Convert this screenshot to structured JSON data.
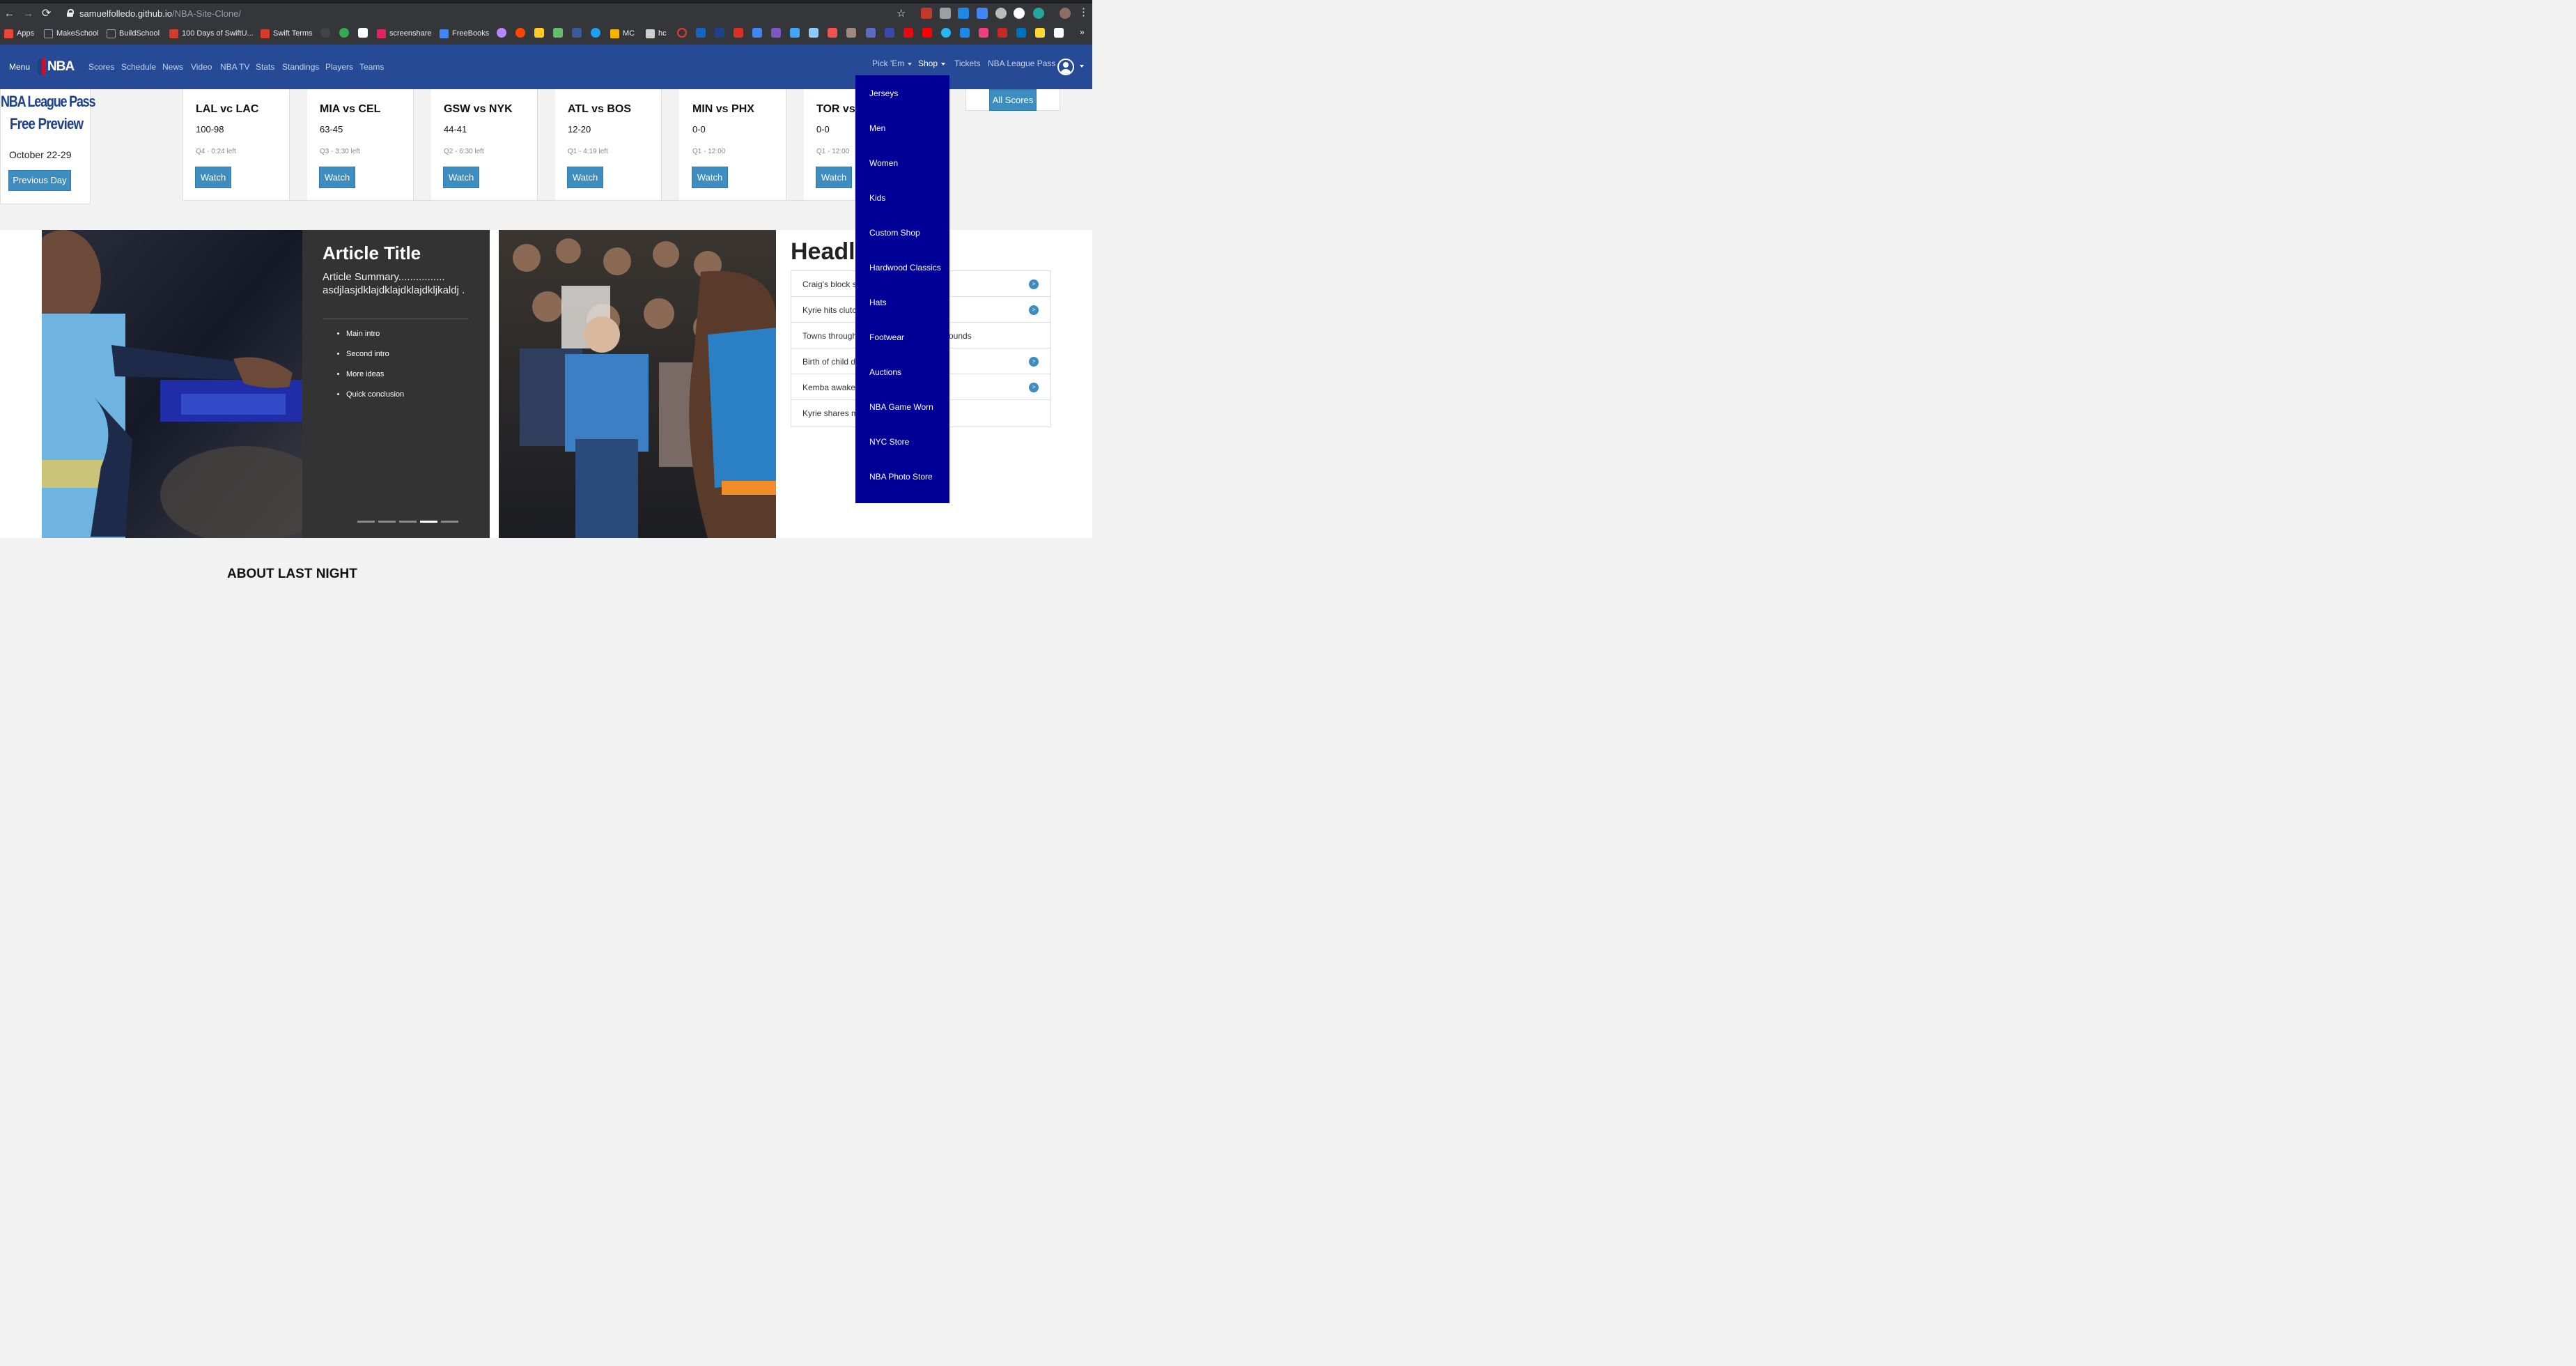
{
  "browser": {
    "url_host": "samuelfolledo.github.io",
    "url_path": "/NBA-Site-Clone/",
    "bookmarks": [
      {
        "label": "Apps",
        "color": "#e8453c"
      },
      {
        "label": "MakeSchool",
        "color": "#9aa0a6"
      },
      {
        "label": "BuildSchool",
        "color": "#9aa0a6"
      },
      {
        "label": "100 Days of SwiftU...",
        "color": "#d33b2c"
      },
      {
        "label": "Swift Terms",
        "color": "#d33b2c"
      },
      {
        "label": "screenshare",
        "color": "#e0245e"
      },
      {
        "label": "FreeBooks",
        "color": "#4285f4"
      },
      {
        "label": "MC",
        "color": "#f4b400"
      },
      {
        "label": "hc",
        "color": "#cfcfcf"
      }
    ],
    "icons": {
      "back": "←",
      "forward": "→",
      "reload": "⟳",
      "star": "☆"
    }
  },
  "header": {
    "menu_label": "Menu",
    "logo_text": "NBA",
    "nav": [
      "Scores",
      "Schedule",
      "News",
      "Video",
      "NBA TV",
      "Stats",
      "Standings",
      "Players",
      "Teams"
    ],
    "right_nav": {
      "pickem": "Pick 'Em",
      "shop": "Shop",
      "tickets": "Tickets",
      "league_pass": "NBA League Pass"
    }
  },
  "league_pass": {
    "line1": "NBA League Pass",
    "line2": "Free Preview",
    "date": "October 22-29",
    "prev_button": "Previous Day"
  },
  "games": [
    {
      "teams": "LAL vc LAC",
      "score": "100-98",
      "time": "Q4 - 0:24 left",
      "button": "Watch"
    },
    {
      "teams": "MIA vs CEL",
      "score": "63-45",
      "time": "Q3 - 3:30 left",
      "button": "Watch"
    },
    {
      "teams": "GSW vs NYK",
      "score": "44-41",
      "time": "Q2 - 6:30 left",
      "button": "Watch"
    },
    {
      "teams": "ATL vs BOS",
      "score": "12-20",
      "time": "Q1 - 4:19 left",
      "button": "Watch"
    },
    {
      "teams": "MIN vs PHX",
      "score": "0-0",
      "time": "Q1 - 12:00",
      "button": "Watch"
    },
    {
      "teams": "TOR vs",
      "score": "0-0",
      "time": "Q1 - 12:00",
      "button": "Watch"
    }
  ],
  "all_scores": "All Scores",
  "article": {
    "title": "Article Title",
    "summary": "Article Summary................ asdjlasjdklajdklajdklajdkljkaldj .",
    "bullets": [
      "Main intro",
      "Second intro",
      "More ideas",
      "Quick conclusion"
    ],
    "active_slide": 4,
    "slide_count": 5
  },
  "headlines": {
    "title": "Headl",
    "items": [
      {
        "text": "Craig's block se",
        "arrow": true
      },
      {
        "text": "Kyrie hits clutch",
        "arrow": true
      },
      {
        "text": "Towns through",
        "tail": "ounds",
        "arrow": false
      },
      {
        "text": "Birth of child de",
        "arrow": true
      },
      {
        "text": "Kemba awaken",
        "arrow": true
      },
      {
        "text": "Kyrie shares mo",
        "arrow": false
      }
    ]
  },
  "shop_menu": [
    "Jerseys",
    "Men",
    "Women",
    "Kids",
    "Custom Shop",
    "Hardwood Classics",
    "Hats",
    "Footwear",
    "Auctions",
    "NBA Game Worn",
    "NYC Store",
    "NBA Photo Store"
  ],
  "about_heading": "ABOUT LAST NIGHT",
  "colors": {
    "header": "#264a95",
    "dropdown": "#000096",
    "button": "#3d8dc0",
    "article_bg": "#333333"
  }
}
